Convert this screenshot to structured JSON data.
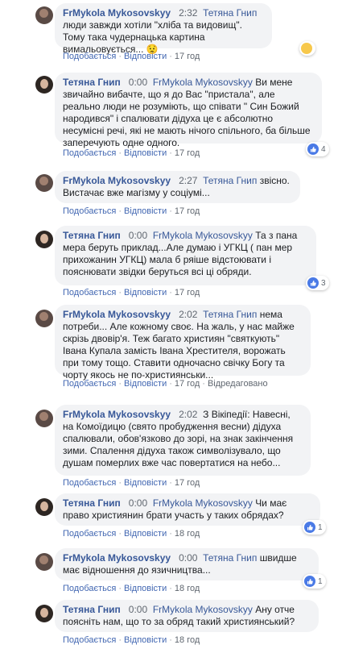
{
  "comments": [
    {
      "author": "FrMykola Mykosovskyy",
      "time": "2:32",
      "reply_to": "Тетяна Гнип",
      "text": "люди завжди хотіли \"хліба та видовищ\". Тому така чудернацька картина вимальовується...",
      "emoji": "😟",
      "like": "Подобається",
      "reply": "Відповісти",
      "age": "17 год"
    },
    {
      "author": "Тетяна Гнип",
      "time": "0:00",
      "reply_to": "FrMykola Mykosovskyy",
      "text": "Ви мене звичайно вибачте, що я до Вас \"пристала\", але реально люди не розуміють, що співати \" Син Божий народився\" і спалювати дідуха це є абсолютно несумісні речі, які не мають нічого спільного, ба більше заперечують одне одного.",
      "like": "Подобається",
      "reply": "Відповісти",
      "age": "17 год",
      "reaction_count": "4"
    },
    {
      "author": "FrMykola Mykosovskyy",
      "time": "2:27",
      "reply_to": "Тетяна Гнип",
      "text": "звісно. Вистачає вже магізму у соціумі...",
      "like": "Подобається",
      "reply": "Відповісти",
      "age": "17 год"
    },
    {
      "author": "Тетяна Гнип",
      "time": "0:00",
      "reply_to": "FrMykola Mykosovskyy",
      "text": "Та з пана мера беруть приклад...Але думаю і УГКЦ ( пан мер прихожанин УГКЦ) мала б ряіше відстоювати і пояснювати звідки беруться всі ці обряди.",
      "like": "Подобається",
      "reply": "Відповісти",
      "age": "17 год",
      "reaction_count": "3"
    },
    {
      "author": "FrMykola Mykosovskyy",
      "time": "2:02",
      "reply_to": "Тетяна Гнип",
      "text": "нема потреби... Але кожному своє. На жаль, у нас майже скрізь двовір'я. Теж багато християн \"святкують\" Івана Купала замість Івана Хрестителя, ворожать при тому тощо. Ставити одночасно свічку Богу та чорту якось не по-християнськи...",
      "like": "Подобається",
      "reply": "Відповісти",
      "age": "17 год",
      "edited": "Відредаговано"
    },
    {
      "author": "FrMykola Mykosovskyy",
      "time": "2:02",
      "text": "З Вікіпедії: Навесні, на Комоїдицю (свято пробудження весни) дідуха спалювали, обов'язково до зорі, на знак закінчення зими. Спалення дідуха також символізувало, що душам померлих вже час повертатися на небо...",
      "like": "Подобається",
      "reply": "Відповісти",
      "age": "17 год"
    },
    {
      "author": "Тетяна Гнип",
      "time": "0:00",
      "reply_to": "FrMykola Mykosovskyy",
      "text": "Чи має право християнин брати участь у таких обрядах?",
      "like": "Подобається",
      "reply": "Відповісти",
      "age": "18 год",
      "reaction_count": "1"
    },
    {
      "author": "FrMykola Mykosovskyy",
      "time": "0:00",
      "reply_to": "Тетяна Гнип",
      "text": "швидше має відношення до язичництва...",
      "like": "Подобається",
      "reply": "Відповісти",
      "age": "18 год",
      "reaction_count": "1"
    },
    {
      "author": "Тетяна Гнип",
      "time": "0:00",
      "reply_to": "FrMykola Mykosovskyy",
      "text": "Ану отче поясніть нам, що то за обряд такий християнський?",
      "like": "Подобається",
      "reply": "Відповісти",
      "age": "18 год"
    }
  ]
}
